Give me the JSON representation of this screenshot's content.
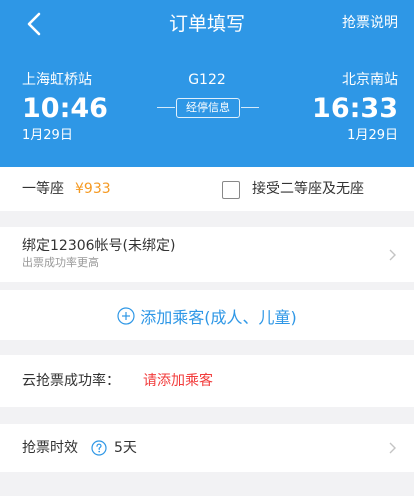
{
  "nav": {
    "title": "订单填写",
    "action": "抢票说明",
    "back_icon": "back-arrow-icon"
  },
  "trip": {
    "from_station": "上海虹桥站",
    "from_time": "10:46",
    "from_date": "1月29日",
    "train_no": "G122",
    "stops_label": "经停信息",
    "to_station": "北京南站",
    "to_time": "16:33",
    "to_date": "1月29日"
  },
  "seat": {
    "label": "一等座",
    "price": "¥933",
    "accept_label": "接受二等座及无座",
    "accept_checked": false
  },
  "bind": {
    "title": "绑定12306帐号(未绑定)",
    "subtitle": "出票成功率更高"
  },
  "passenger": {
    "add_label": "添加乘客(成人、儿童)"
  },
  "rate": {
    "label": "云抢票成功率：",
    "value": "请添加乘客"
  },
  "validity": {
    "label": "抢票时效",
    "value": "5天"
  },
  "colors": {
    "brand_blue": "#2e97e6",
    "price_orange": "#f59a23",
    "warning_red": "#f23c3c",
    "background": "#f2f2f4"
  }
}
